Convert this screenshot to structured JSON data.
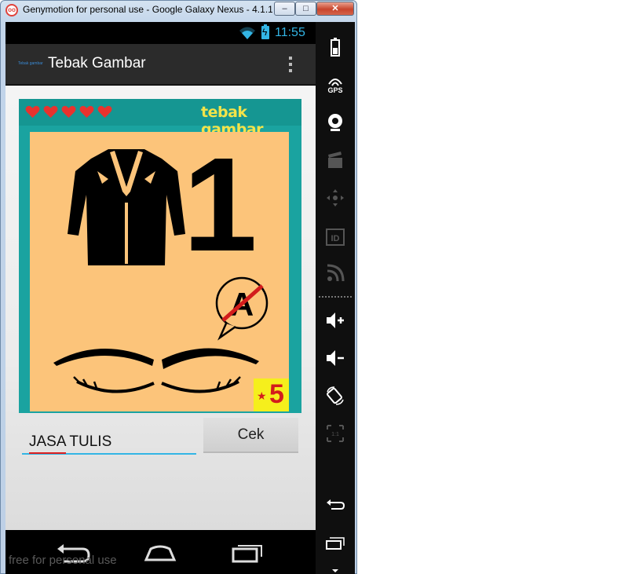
{
  "window": {
    "title": "Genymotion for personal use - Google Galaxy Nexus - 4.1.1 - API 16 - 720x1280",
    "minimize_glyph": "–",
    "maximize_glyph": "□",
    "close_glyph": "✕"
  },
  "status_bar": {
    "time": "11:55",
    "wifi_icon": "wifi-icon",
    "battery_icon": "battery-charging-icon"
  },
  "action_bar": {
    "logo_text": "Tebak gambar",
    "title": "Tebak Gambar",
    "overflow_icon": "overflow-menu-icon"
  },
  "game": {
    "lives": 5,
    "brand": "tebak gambar",
    "clue_number": "1",
    "clue_letter": "A",
    "points": "5",
    "star_glyph": "★"
  },
  "answer": {
    "value": "JASA TULIS"
  },
  "check_button": {
    "label": "Cek"
  },
  "nav_bar": {
    "icons": [
      "back-icon",
      "home-icon",
      "recents-icon"
    ]
  },
  "watermark": "free for personal use",
  "sidebar": {
    "gps_label": "GPS",
    "items": [
      "battery-icon",
      "gps-icon",
      "webcam-icon",
      "media-icon",
      "dpad-icon",
      "id-icon",
      "rss-icon",
      "volume-up-icon",
      "volume-down-icon",
      "rotate-icon",
      "scale-icon",
      "back-icon",
      "recents-icon",
      "menu-down-icon"
    ]
  },
  "colors": {
    "accent": "#33b5e5",
    "puzzle_frame": "#1aa3a0",
    "puzzle_bg": "#fcc47a",
    "brand_yellow": "#f2e34a",
    "heart_red": "#e8322e",
    "badge_yellow": "#f5ef1c",
    "badge_red": "#d31c1c"
  }
}
